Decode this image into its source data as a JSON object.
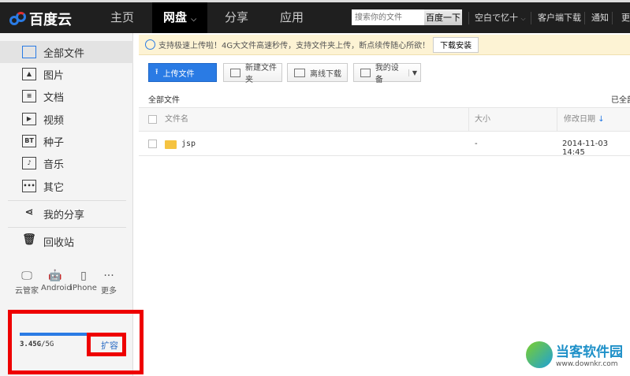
{
  "topbar": {
    "logo": "百度云",
    "nav": [
      "主页",
      "网盘",
      "分享",
      "应用"
    ],
    "search_placeholder": "搜索你的文件",
    "search_button": "百度一下",
    "user": "空白で忆十",
    "links": [
      "客户端下载",
      "通知",
      "更"
    ]
  },
  "sidebar": {
    "items": [
      "全部文件",
      "图片",
      "文档",
      "视频",
      "种子",
      "音乐",
      "其它",
      "我的分享",
      "回收站"
    ],
    "devices": [
      "云管家",
      "Android",
      "iPhone",
      "更多"
    ],
    "quota_used": "3.45G",
    "quota_total": "/5G",
    "quota_fraction": 0.69,
    "expand": "扩容"
  },
  "notice": {
    "text": "支持极速上传啦！4G大文件高速秒传，支持文件夹上传，断点续传随心所欲！",
    "button": "下载安装"
  },
  "toolbar": {
    "upload": "上传文件",
    "new_folder": "新建文件夹",
    "offline": "离线下载",
    "device": "我的设备"
  },
  "breadcrumb": "全部文件",
  "loaded": "已全部",
  "table": {
    "headers": [
      "文件名",
      "大小",
      "修改日期"
    ],
    "rows": [
      {
        "name": "jsp",
        "size": "-",
        "date": "2014-11-03 14:45"
      }
    ]
  },
  "watermark": {
    "title": "当客软件园",
    "url": "www.downkr.com"
  }
}
